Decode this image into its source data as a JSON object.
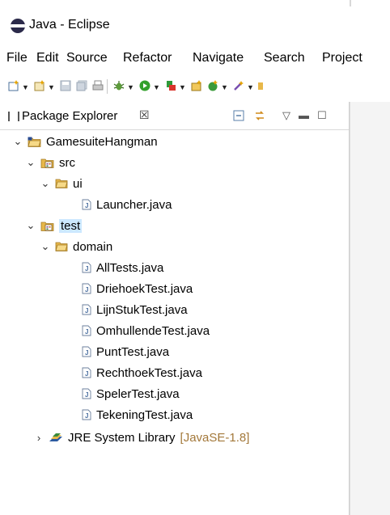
{
  "window": {
    "title": "Java - Eclipse"
  },
  "menu": [
    "File",
    "Edit",
    "Source",
    "Refactor",
    "Navigate",
    "Search",
    "Project"
  ],
  "toolbar": {
    "icons": [
      "new-wizard-icon",
      "new-project-icon",
      "save-icon",
      "save-all-icon",
      "print-icon",
      "debug-icon",
      "run-icon",
      "run-external-icon",
      "new-class-icon",
      "new-package-icon",
      "open-type-icon"
    ]
  },
  "view": {
    "tab_label": "Package Explorer",
    "close_glyph": "☒",
    "minimize_glyph": "▬",
    "maximize_glyph": "☐",
    "menu_glyph": "▽"
  },
  "tree": {
    "project": "GamesuiteHangman",
    "src_folder": "src",
    "ui_package": "ui",
    "launcher": "Launcher.java",
    "test_folder": "test",
    "domain_package": "domain",
    "test_files": [
      "AllTests.java",
      "DriehoekTest.java",
      "LijnStukTest.java",
      "OmhullendeTest.java",
      "PuntTest.java",
      "RechthoekTest.java",
      "SpelerTest.java",
      "TekeningTest.java"
    ],
    "jre_label": "JRE System Library",
    "jre_decoration": "[JavaSE-1.8]"
  },
  "colors": {
    "selection": "#cce8ff",
    "folder": "#e8b84a",
    "decoration": "#a3783a"
  }
}
